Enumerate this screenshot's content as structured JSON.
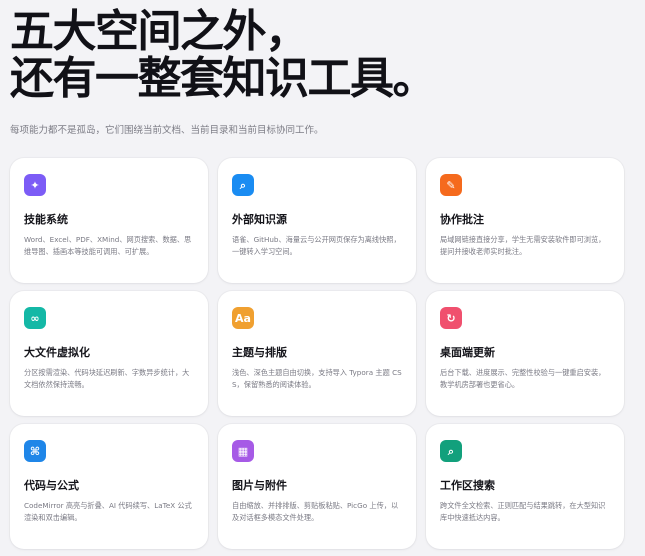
{
  "hero": {
    "title_line1": "五大空间之外，",
    "title_line2": "还有一整套知识工具。",
    "subtitle": "每项能力都不是孤岛，它们围绕当前文档、当前目录和当前目标协同工作。"
  },
  "features": [
    {
      "title": "技能系统",
      "desc": "Word、Excel、PDF、XMind、网页搜索、数据、思维导图、插画本等技能可调用、可扩展。",
      "icon": "sparkle-icon",
      "glyph": "✦",
      "color": "#7c5cf6"
    },
    {
      "title": "外部知识源",
      "desc": "语雀、GitHub、海量云与公开网页保存为离线快照，一键转入学习空间。",
      "icon": "search-icon",
      "glyph": "⌕",
      "color": "#1a8cf2"
    },
    {
      "title": "协作批注",
      "desc": "局域网链接直接分享，学生无需安装软件即可浏览，提问并接收老师实时批注。",
      "icon": "comment-icon",
      "glyph": "✎",
      "color": "#f56a1d"
    },
    {
      "title": "大文件虚拟化",
      "desc": "分区按需渲染、代码块延迟刷新、字数异步统计，大文档依然保持流畅。",
      "icon": "infinity-icon",
      "glyph": "∞",
      "color": "#14b8a6"
    },
    {
      "title": "主题与排版",
      "desc": "浅色、深色主题自由切换，支持导入 Typora 主题 CSS，保留熟悉的阅读体验。",
      "icon": "typography-icon",
      "glyph": "Aa",
      "color": "#f0a030"
    },
    {
      "title": "桌面端更新",
      "desc": "后台下载、进度展示、完整性校验与一键重启安装，教学机房部署也更省心。",
      "icon": "refresh-icon",
      "glyph": "↻",
      "color": "#f0506e"
    },
    {
      "title": "代码与公式",
      "desc": "CodeMirror 高亮与折叠、AI 代码续写、LaTeX 公式渲染和双击编辑。",
      "icon": "command-icon",
      "glyph": "⌘",
      "color": "#1f86e8"
    },
    {
      "title": "图片与附件",
      "desc": "自由缩放、并排排版、剪贴板粘贴、PicGo 上传，以及对话框多模态文件处理。",
      "icon": "image-icon",
      "glyph": "▦",
      "color": "#a65ae6"
    },
    {
      "title": "工作区搜索",
      "desc": "跨文件全文检索、正则匹配与结果跳转，在大型知识库中快速抵达内容。",
      "icon": "search-icon",
      "glyph": "⌕",
      "color": "#12a07c"
    }
  ]
}
